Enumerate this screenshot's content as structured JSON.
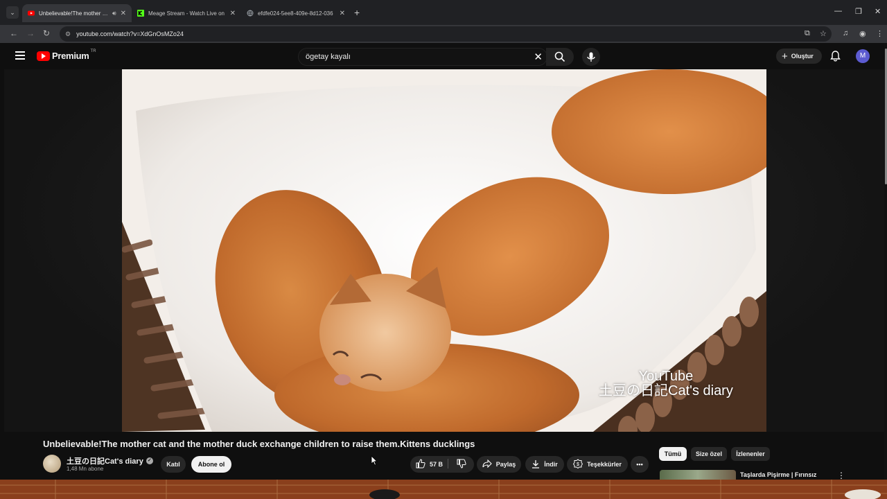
{
  "browser": {
    "tabs": [
      {
        "title": "Unbelievable!The mother cat and the mother duck",
        "active": true,
        "favicon": "youtube-icon",
        "favicon_color": "#ff0000"
      },
      {
        "title": "Meage Stream - Watch Live on",
        "active": false,
        "favicon": "kick-icon",
        "favicon_color": "#53fc18"
      },
      {
        "title": "efdfe024-5ee8-409e-8d12-036",
        "active": false,
        "favicon": "globe-icon",
        "favicon_color": "#9aa0a6"
      }
    ],
    "url": "youtube.com/watch?v=XdGnOsMZo24"
  },
  "header": {
    "logo_text": "Premium",
    "country_code": "TR",
    "search_value": "ögetay kayalı",
    "create_label": "Oluştur",
    "avatar_letter": "M"
  },
  "video": {
    "watermark_line1": "YouTube",
    "watermark_line2": "土豆の日記Cat's diary",
    "title": "Unbelievable!The mother cat and the mother duck exchange children to raise them.Kittens ducklings"
  },
  "channel": {
    "name": "土豆の日記Cat's diary",
    "subscribers": "1,48 Mn abone",
    "join_label": "Katıl",
    "subscribe_label": "Abone ol"
  },
  "actions": {
    "likes": "57 B",
    "share_label": "Paylaş",
    "download_label": "İndir",
    "thanks_label": "Teşekkürler"
  },
  "chips": [
    "Tümü",
    "Size özel",
    "İzlenenler"
  ],
  "recommendation": {
    "title": "Taşlarda Pişirme | Fırınsız"
  },
  "colors": {
    "accent_red": "#ff0000",
    "background": "#0f0f0f",
    "avatar_purple": "#5c5bd1"
  }
}
